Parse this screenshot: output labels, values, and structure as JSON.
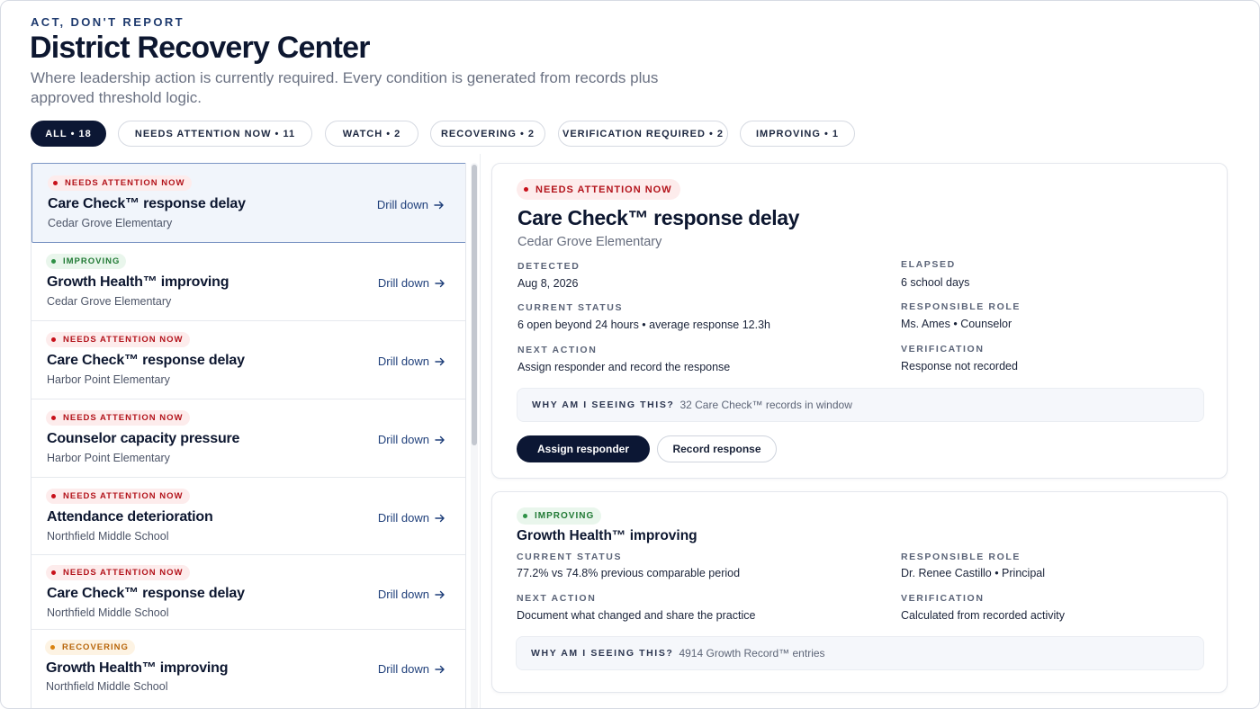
{
  "header": {
    "eyebrow": "ACT, DON'T REPORT",
    "title": "District Recovery Center",
    "subtitle": "Where leadership action is currently required. Every condition is generated from records plus approved threshold logic."
  },
  "filters": [
    {
      "label": "ALL",
      "count": "18",
      "active": true
    },
    {
      "label": "NEEDS ATTENTION NOW",
      "count": "11"
    },
    {
      "label": "WATCH",
      "count": "2"
    },
    {
      "label": "RECOVERING",
      "count": "2"
    },
    {
      "label": "VERIFICATION REQUIRED",
      "count": "2"
    },
    {
      "label": "IMPROVING",
      "count": "1"
    }
  ],
  "list": {
    "drill_label": "Drill down",
    "items": [
      {
        "status": "NEEDS ATTENTION NOW",
        "tone": "red",
        "title": "Care Check™ response delay",
        "school": "Cedar Grove Elementary"
      },
      {
        "status": "IMPROVING",
        "tone": "green",
        "title": "Growth Health™ improving",
        "school": "Cedar Grove Elementary"
      },
      {
        "status": "NEEDS ATTENTION NOW",
        "tone": "red",
        "title": "Care Check™ response delay",
        "school": "Harbor Point Elementary"
      },
      {
        "status": "NEEDS ATTENTION NOW",
        "tone": "red",
        "title": "Counselor capacity pressure",
        "school": "Harbor Point Elementary"
      },
      {
        "status": "NEEDS ATTENTION NOW",
        "tone": "red",
        "title": "Attendance deterioration",
        "school": "Northfield Middle School"
      },
      {
        "status": "NEEDS ATTENTION NOW",
        "tone": "red",
        "title": "Care Check™ response delay",
        "school": "Northfield Middle School"
      },
      {
        "status": "RECOVERING",
        "tone": "amber",
        "title": "Growth Health™ improving",
        "school": "Northfield Middle School"
      }
    ]
  },
  "detail": {
    "status": "NEEDS ATTENTION NOW",
    "title": "Care Check™ response delay",
    "school": "Cedar Grove Elementary",
    "detected_label": "DETECTED",
    "detected": "Aug 8, 2026",
    "elapsed_label": "ELAPSED",
    "elapsed": "6 school days",
    "current_status_label": "CURRENT STATUS",
    "current_status": "6 open beyond 24 hours • average response 12.3h",
    "role_label": "RESPONSIBLE ROLE",
    "role": "Ms. Ames • Counselor",
    "next_action_label": "NEXT ACTION",
    "next_action": "Assign responder and record the response",
    "verification_label": "VERIFICATION",
    "verification": "Response not recorded",
    "why_label": "WHY AM I SEEING THIS?",
    "why_text": "32 Care Check™ records in window",
    "primary_button": "Assign responder",
    "secondary_button": "Record response"
  },
  "detail2": {
    "status": "IMPROVING",
    "title": "Growth Health™ improving",
    "current_status_label": "CURRENT STATUS",
    "current_status": "77.2% vs 74.8% previous comparable period",
    "role_label": "RESPONSIBLE ROLE",
    "role": "Dr. Renee Castillo • Principal",
    "next_action_label": "NEXT ACTION",
    "next_action": "Document what changed and share the practice",
    "verification_label": "VERIFICATION",
    "verification": "Calculated from recorded activity",
    "why_label": "WHY AM I SEEING THIS?",
    "why_text": "4914 Growth Record™ entries"
  },
  "colors": {
    "navy": "#0c1734",
    "attention_red": "#b3131b",
    "improving_green": "#217a35",
    "recovering_amber": "#b8650a",
    "link_blue": "#1f3f7a"
  }
}
